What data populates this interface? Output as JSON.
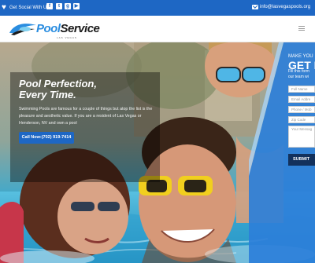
{
  "topbar": {
    "social_label": "Get Social With Us:",
    "social_icons": [
      "facebook-icon",
      "twitter-icon",
      "google-plus-icon",
      "youtube-icon"
    ],
    "social_glyphs": [
      "f",
      "t",
      "g",
      "▶"
    ],
    "email": "info@lasvegaspools.org"
  },
  "logo": {
    "text_part1": "Pool",
    "text_part2": "Service",
    "tagline": "LAS VEGAS"
  },
  "hero": {
    "title_line1": "Pool Perfection,",
    "title_line2": "Every Time.",
    "body": "Swimming Pools are famous for a couple of things but atop the list is the pleasure and aesthetic value. If you are a resident of Las Vegas or Henderson, NV and own a pool",
    "cta_label": "Call Now:(702) 919-7414"
  },
  "form": {
    "eyebrow": "MAKE YOU",
    "heading": "GET I",
    "subtext_line1": "Fill this form",
    "subtext_line2": "our team wi",
    "fields": [
      "Full Name",
      "Email Addre",
      "Phone / Mob",
      "Zip Code"
    ],
    "message_placeholder": "Your Messag",
    "submit_label": "SUBMIT"
  },
  "colors": {
    "brand_blue": "#1e67c4",
    "panel_blue": "#2d7fd9",
    "submit_navy": "#13315c"
  }
}
